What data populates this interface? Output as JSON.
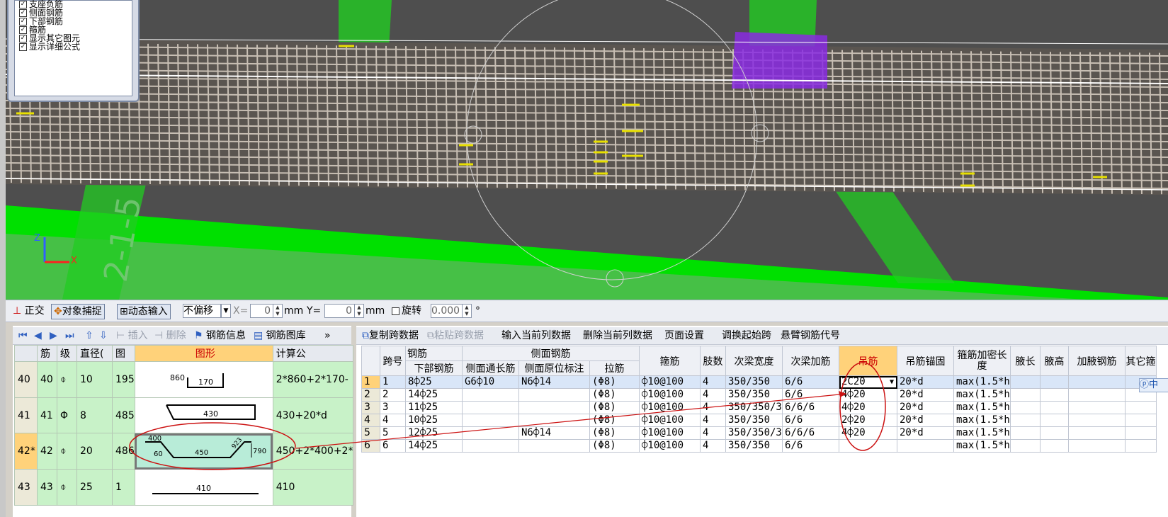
{
  "layer_panel": {
    "items": [
      {
        "label": "支座负筋",
        "checked": true
      },
      {
        "label": "侧面钢筋",
        "checked": true
      },
      {
        "label": "下部钢筋",
        "checked": true
      },
      {
        "label": "箍筋",
        "checked": true
      },
      {
        "label": "显示其它图元",
        "checked": true
      },
      {
        "label": "显示详细公式",
        "checked": true
      }
    ]
  },
  "viewport": {
    "beam_label": "2-1-5"
  },
  "toolbar": {
    "ortho": "正交",
    "snap": "对象捕捉",
    "dynamic_input": "动态输入",
    "offset_select": "不偏移",
    "x_label": "X=",
    "x_value": "0",
    "x_unit": "mm",
    "y_label": "Y=",
    "y_value": "0",
    "y_unit": "mm",
    "rotate_label": "旋转",
    "rotate_value": "0.000",
    "degree": "°"
  },
  "left_panel": {
    "toolbar": {
      "insert": "插入",
      "delete": "删除",
      "rebar_info": "钢筋信息",
      "rebar_library": "钢筋图库",
      "more": "»"
    },
    "columns": [
      "",
      "筋",
      "级",
      "直径(",
      "图",
      "图形",
      "计算公"
    ],
    "rows": [
      {
        "rownum": "40",
        "bar": "40",
        "grade": "⌽",
        "dia": "10",
        "fig": "195",
        "formula": "2*860+2*170-"
      },
      {
        "rownum": "41",
        "bar": "41",
        "grade": "Φ",
        "dia": "8",
        "fig": "485",
        "formula": "430+20*d"
      },
      {
        "rownum": "42*",
        "bar": "42",
        "grade": "⌽",
        "dia": "20",
        "fig": "486",
        "formula": "450+2*400+2*"
      },
      {
        "rownum": "43",
        "bar": "43",
        "grade": "⌽",
        "dia": "25",
        "fig": "1",
        "formula": "410"
      }
    ],
    "shapes": {
      "s40_a": "860",
      "s40_b": "170",
      "s41_a": "430",
      "s42_a": "400",
      "s42_b": "60",
      "s42_c": "450",
      "s42_d": "923",
      "s42_e": "790",
      "s43_a": "410"
    }
  },
  "right_panel": {
    "toolbar": {
      "copy_span": "复制跨数据",
      "paste_span": "粘贴跨数据",
      "input_col": "输入当前列数据",
      "delete_col": "删除当前列数据",
      "page_setup": "页面设置",
      "adjust_start": "调换起始跨",
      "cantilever": "悬臂钢筋代号"
    },
    "headers": {
      "span": "跨号",
      "rebar_group": "钢筋",
      "bottom": "下部钢筋",
      "side_group": "侧面钢筋",
      "side_through": "侧面通长筋",
      "side_orig": "侧面原位标注",
      "tie": "拉筋",
      "stirrup": "箍筋",
      "legs": "肢数",
      "sec_width": "次梁宽度",
      "sec_add": "次梁加筋",
      "hanger": "吊筋",
      "hanger_anchor": "吊筋锚固",
      "stir_len": "箍筋加密长度",
      "haunch_len": "腋长",
      "haunch_h": "腋高",
      "haunch_bar": "加腋钢筋",
      "other": "其它箍"
    },
    "rows": [
      {
        "rn": "1",
        "span": "1",
        "bottom": "8⌽25",
        "side_through": "G6⌽10",
        "side_orig": "N6⌽14",
        "tie": "(Φ8)",
        "stirrup": "⌽10@100",
        "legs": "4",
        "sec_width": "350/350",
        "sec_add": "6/6",
        "hanger": "2C20",
        "hanger_anchor": "20*d",
        "stir_len": "max(1.5*h"
      },
      {
        "rn": "2",
        "span": "2",
        "bottom": "14⌽25",
        "side_through": "",
        "side_orig": "",
        "tie": "(Φ8)",
        "stirrup": "⌽10@100",
        "legs": "4",
        "sec_width": "350/350",
        "sec_add": "6/6",
        "hanger": "4⌽20",
        "hanger_anchor": "20*d",
        "stir_len": "max(1.5*h"
      },
      {
        "rn": "3",
        "span": "3",
        "bottom": "11⌽25",
        "side_through": "",
        "side_orig": "",
        "tie": "(Φ8)",
        "stirrup": "⌽10@100",
        "legs": "4",
        "sec_width": "350/350/3",
        "sec_add": "6/6/6",
        "hanger": "4⌽20",
        "hanger_anchor": "20*d",
        "stir_len": "max(1.5*h"
      },
      {
        "rn": "4",
        "span": "4",
        "bottom": "10⌽25",
        "side_through": "",
        "side_orig": "",
        "tie": "(Φ8)",
        "stirrup": "⌽10@100",
        "legs": "4",
        "sec_width": "350/350",
        "sec_add": "6/6",
        "hanger": "2⌽20",
        "hanger_anchor": "20*d",
        "stir_len": "max(1.5*h"
      },
      {
        "rn": "5",
        "span": "5",
        "bottom": "12⌽25",
        "side_through": "",
        "side_orig": "N6⌽14",
        "tie": "(Φ8)",
        "stirrup": "⌽10@100",
        "legs": "4",
        "sec_width": "350/350/3",
        "sec_add": "6/6/6",
        "hanger": "4⌽20",
        "hanger_anchor": "20*d",
        "stir_len": "max(1.5*h"
      },
      {
        "rn": "6",
        "span": "6",
        "bottom": "14⌽25",
        "side_through": "",
        "side_orig": "",
        "tie": "(Φ8)",
        "stirrup": "⌽10@100",
        "legs": "4",
        "sec_width": "350/350",
        "sec_add": "6/6",
        "hanger": "",
        "hanger_anchor": "",
        "stir_len": "max(1.5*h"
      }
    ],
    "ime": "中"
  }
}
